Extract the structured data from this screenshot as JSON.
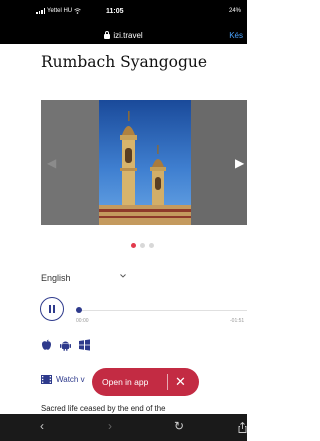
{
  "status_bar": {
    "carrier": "Yettel HU",
    "time": "11:05",
    "battery": "24%"
  },
  "browser": {
    "url": "izi.travel",
    "action": "Kés"
  },
  "page": {
    "title": "Rumbach Syangogue",
    "carousel": {
      "slide_count": 3,
      "active_slide": 1
    },
    "language": "English",
    "player": {
      "current_time": "00:00",
      "end_time": "-01:51",
      "progress": 0
    },
    "apps": [
      "apple-icon",
      "android-icon",
      "windows-icon"
    ],
    "watch_label": "Watch v",
    "open_in_app": {
      "label": "Open in app",
      "close": "✕"
    },
    "body_text": "Sacred life ceased by the end of the"
  },
  "bottom_nav": {
    "back": "‹",
    "forward": "›",
    "reload": "↻"
  }
}
